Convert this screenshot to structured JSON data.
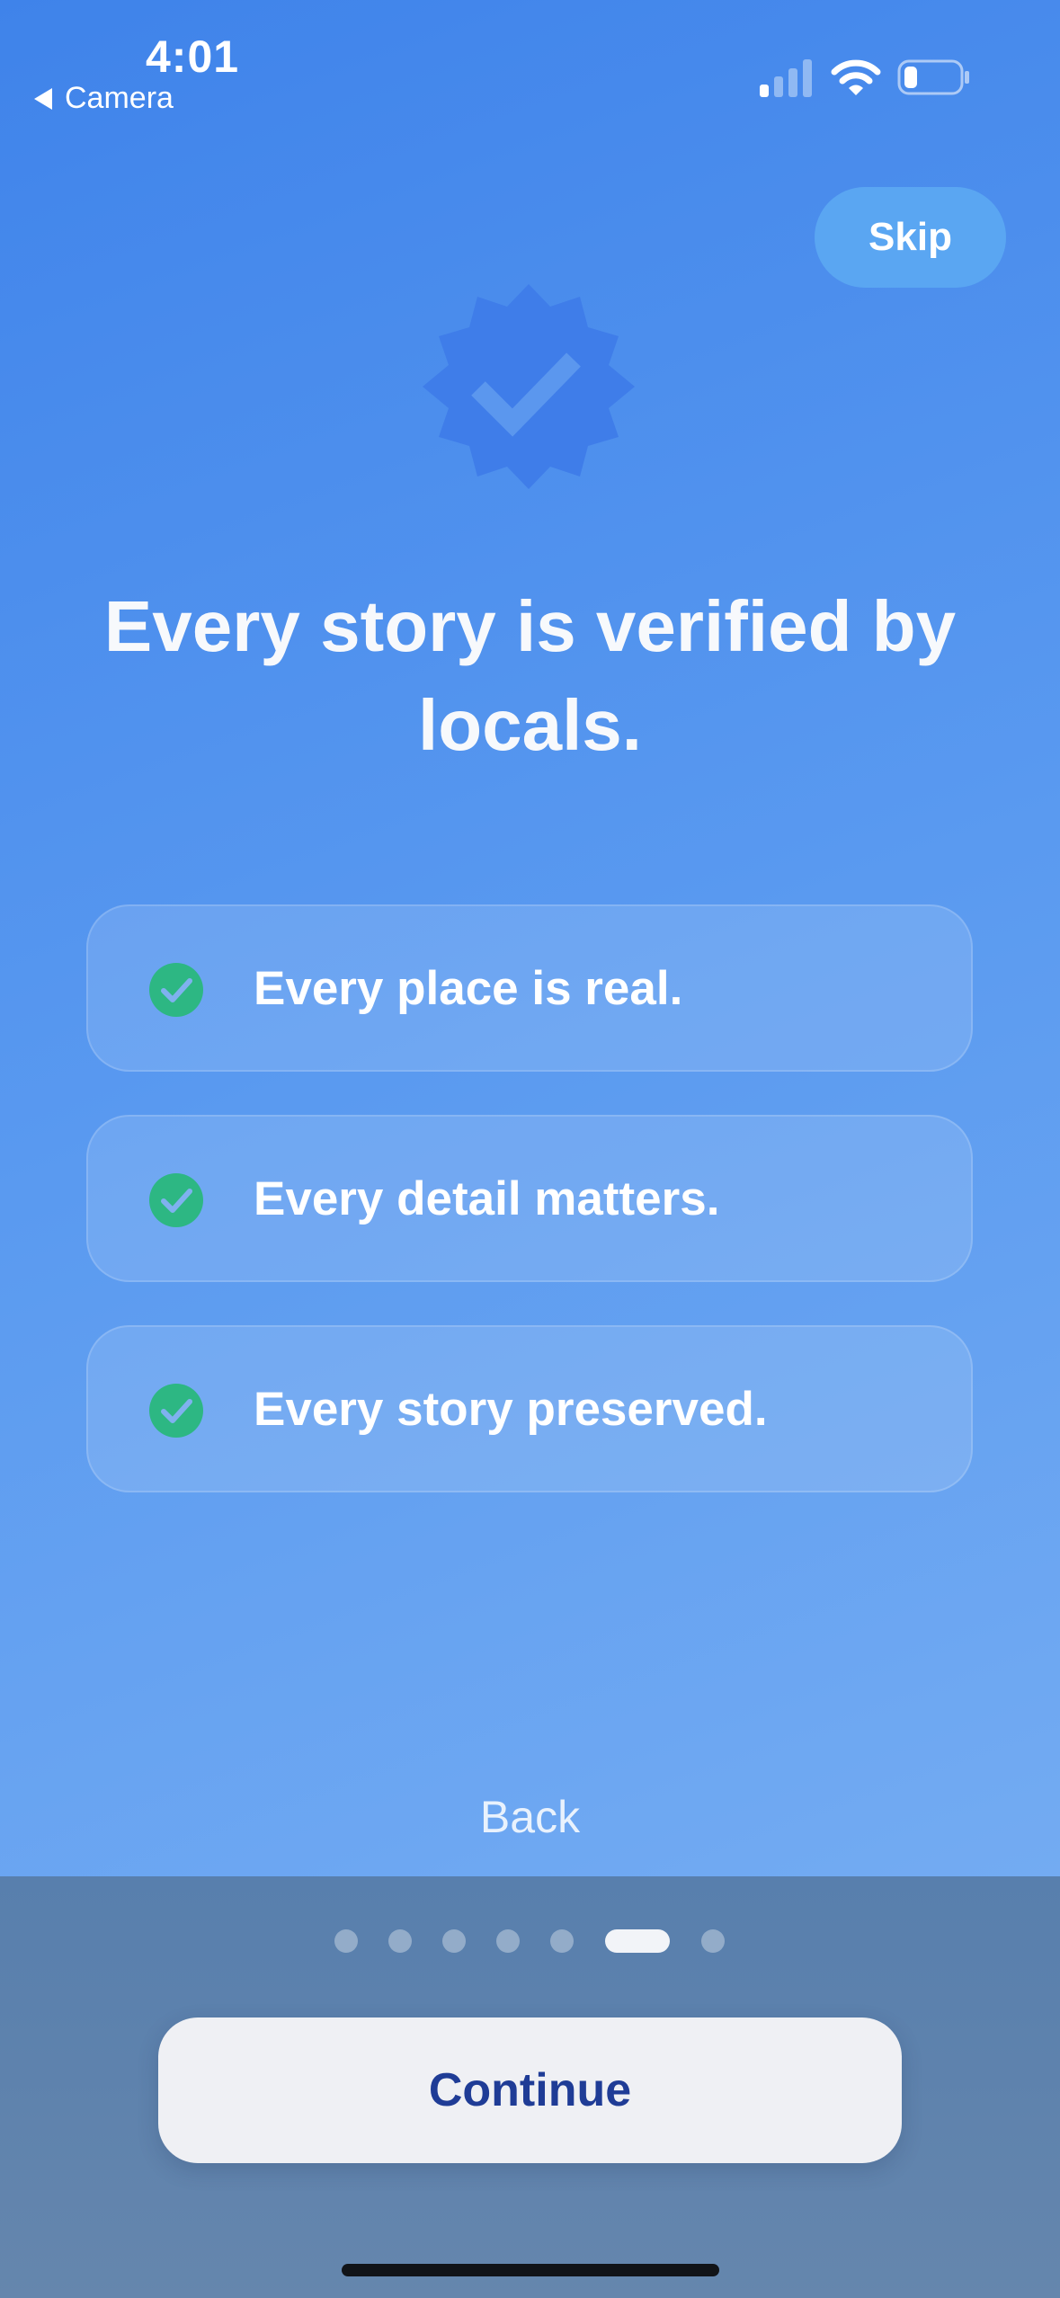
{
  "status_bar": {
    "time": "4:01",
    "back_app_label": "Camera",
    "icons": [
      "back-triangle-icon",
      "cellular-signal-icon",
      "wifi-icon",
      "battery-icon"
    ]
  },
  "skip_label": "Skip",
  "badge_icon": "verified-badge-icon",
  "headline": "Every story is verified by locals.",
  "features": [
    {
      "label": "Every place is real.",
      "icon": "check-circle-icon"
    },
    {
      "label": "Every detail matters.",
      "icon": "check-circle-icon"
    },
    {
      "label": "Every story preserved.",
      "icon": "check-circle-icon"
    }
  ],
  "back_label": "Back",
  "pagination": {
    "total": 7,
    "current": 6
  },
  "continue_label": "Continue",
  "colors": {
    "background_top": "#3f83ea",
    "background_bottom": "#7db2f3",
    "check_green": "#2db783",
    "continue_text": "#1f3c96",
    "panel": "#5b80ad"
  }
}
